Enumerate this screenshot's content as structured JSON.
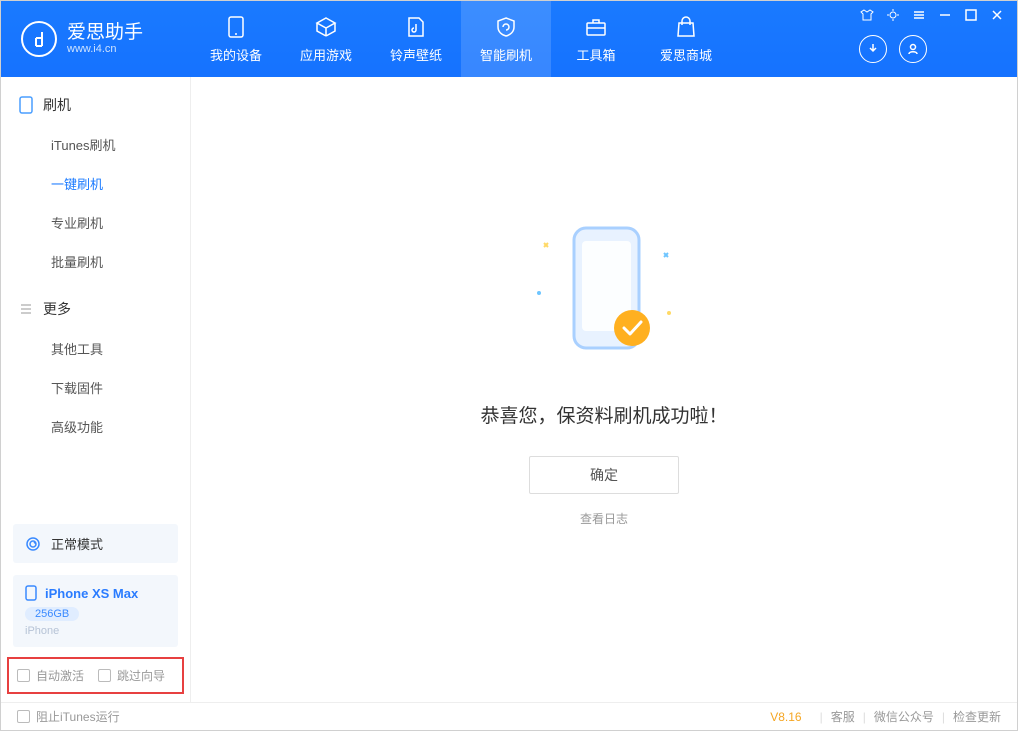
{
  "app": {
    "title": "爱思助手",
    "subtitle": "www.i4.cn"
  },
  "tabs": {
    "device": "我的设备",
    "apps": "应用游戏",
    "wallpaper": "铃声壁纸",
    "flash": "智能刷机",
    "toolbox": "工具箱",
    "store": "爱思商城"
  },
  "sidebar": {
    "section_flash": "刷机",
    "items_flash": {
      "itunes": "iTunes刷机",
      "oneclick": "一键刷机",
      "pro": "专业刷机",
      "batch": "批量刷机"
    },
    "section_more": "更多",
    "items_more": {
      "other": "其他工具",
      "firmware": "下载固件",
      "advanced": "高级功能"
    },
    "mode": "正常模式",
    "device": {
      "name": "iPhone XS Max",
      "capacity": "256GB",
      "type": "iPhone"
    },
    "checks": {
      "auto_activate": "自动激活",
      "skip_guide": "跳过向导"
    }
  },
  "main": {
    "success": "恭喜您，保资料刷机成功啦！",
    "ok": "确定",
    "view_log": "查看日志"
  },
  "footer": {
    "block_itunes": "阻止iTunes运行",
    "version": "V8.16",
    "support": "客服",
    "wechat": "微信公众号",
    "update": "检查更新"
  }
}
